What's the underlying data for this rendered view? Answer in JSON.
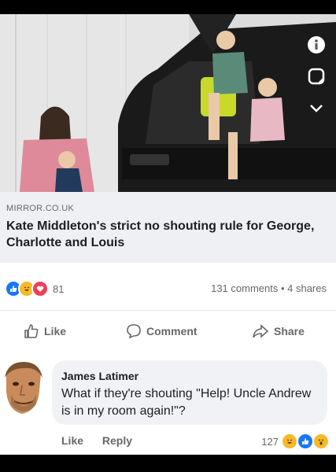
{
  "link": {
    "source": "MIRROR.CO.UK",
    "headline": "Kate Middleton's strict no shouting rule for George, Charlotte and Louis"
  },
  "stats": {
    "reaction_icons": [
      "like-icon",
      "haha-icon",
      "love-icon"
    ],
    "reaction_count": "81",
    "comments_shares": "131 comments • 4 shares"
  },
  "actions": {
    "like": "Like",
    "comment": "Comment",
    "share": "Share"
  },
  "comment": {
    "author": "James Latimer",
    "text": "What if they're shouting \"Help! Uncle Andrew is in my room again!\"?",
    "like": "Like",
    "reply": "Reply",
    "reaction_count": "127",
    "reaction_icons": [
      "haha-icon",
      "like-icon",
      "wow-icon"
    ]
  },
  "colors": {
    "facebook_blue": "#1877f2",
    "reaction_yellow": "#f7b928",
    "love_red": "#f33e58",
    "card_gray": "#eef0f3"
  }
}
